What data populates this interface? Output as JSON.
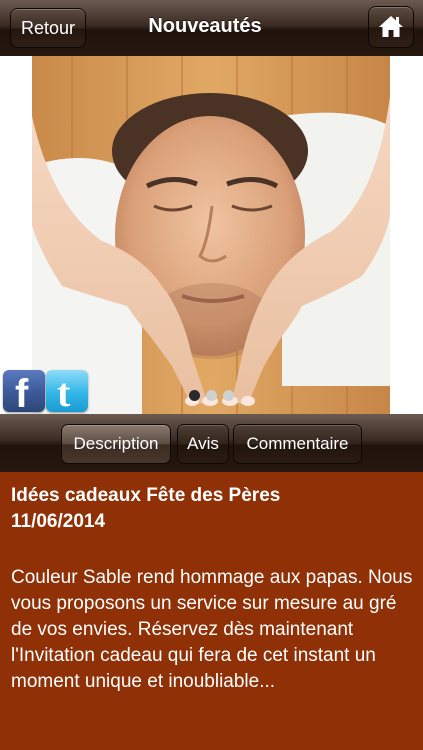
{
  "navbar": {
    "back_label": "Retour",
    "title": "Nouveautés",
    "home_icon": "home-icon"
  },
  "photo": {
    "description": "spa-face-massage-photo",
    "carousel_total": 3,
    "carousel_current": 1
  },
  "social": {
    "facebook_label": "f",
    "twitter_label": "t"
  },
  "tabs": [
    {
      "label": "Description",
      "selected": true
    },
    {
      "label": "Avis",
      "selected": false
    },
    {
      "label": "Commentaire",
      "selected": false
    }
  ],
  "article": {
    "title": "Idées cadeaux Fête des Pères",
    "date": "11/06/2014",
    "body": "Couleur Sable rend hommage aux papas. Nous vous proposons un service sur mesure au gré de vos envies. Réservez dès maintenant l'Invitation cadeau qui fera de cet instant un moment unique et inoubliable..."
  },
  "colors": {
    "bar_dark": "#26180f",
    "content_bg": "#8f3006",
    "text": "#ffffff",
    "facebook": "#3b5998",
    "twitter": "#33b6e8"
  }
}
